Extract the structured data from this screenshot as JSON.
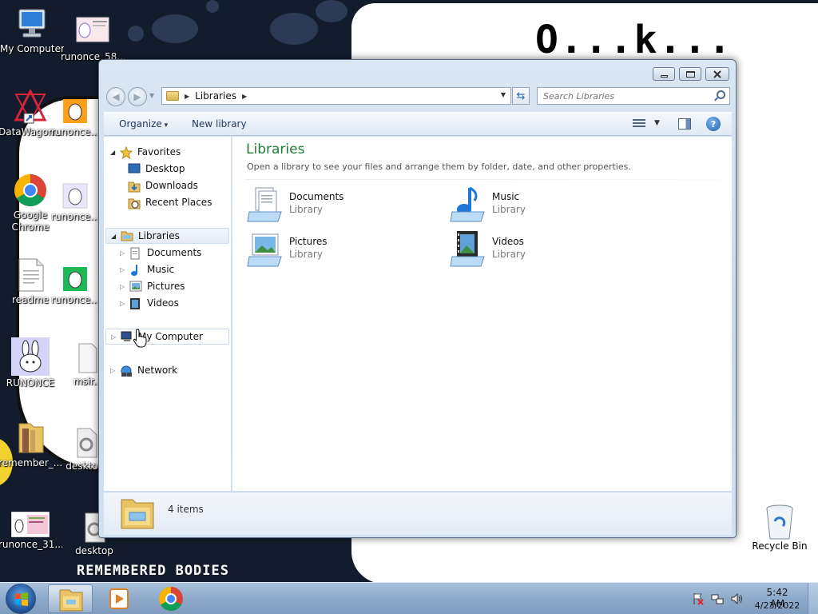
{
  "desktop": {
    "wallpaper_text": "O...k...",
    "wallpaper_bottom_text": "REMEMBERED BODIES",
    "icons": [
      {
        "label": "My Computer",
        "icon": "computer-icon"
      },
      {
        "label": "runonce_58...",
        "icon": "image-file-icon"
      },
      {
        "label": "DataWagon...",
        "icon": "shortcut-icon"
      },
      {
        "label": "runonce...",
        "icon": "image-file-icon"
      },
      {
        "label": "Google Chrome",
        "icon": "chrome-icon"
      },
      {
        "label": "runonce...",
        "icon": "image-file-icon"
      },
      {
        "label": "readme",
        "icon": "text-file-icon"
      },
      {
        "label": "runonce...",
        "icon": "image-file-icon"
      },
      {
        "label": "RUNONCE",
        "icon": "bunny-image-icon"
      },
      {
        "label": "msir...",
        "icon": "file-icon"
      },
      {
        "label": "remember_...",
        "icon": "folder-icon"
      },
      {
        "label": "deskto...",
        "icon": "settings-file-icon"
      },
      {
        "label": "runonce_31...",
        "icon": "image-file-icon"
      },
      {
        "label": "desktop",
        "icon": "settings-file-icon"
      },
      {
        "label": "Recycle Bin",
        "icon": "recycle-bin-icon"
      }
    ]
  },
  "window": {
    "address": {
      "crumbs": [
        "Libraries"
      ]
    },
    "search": {
      "placeholder": "Search Libraries"
    },
    "toolbar": {
      "organize": "Organize",
      "new_library": "New library"
    },
    "nav": {
      "favorites": "Favorites",
      "favorites_items": [
        "Desktop",
        "Downloads",
        "Recent Places"
      ],
      "libraries": "Libraries",
      "libraries_items": [
        "Documents",
        "Music",
        "Pictures",
        "Videos"
      ],
      "computer": "My Computer",
      "network": "Network"
    },
    "content": {
      "title": "Libraries",
      "description": "Open a library to see your files and arrange them by folder, date, and other properties.",
      "libraries": [
        {
          "name": "Documents",
          "type": "Library",
          "icon": "documents-library-icon"
        },
        {
          "name": "Music",
          "type": "Library",
          "icon": "music-library-icon"
        },
        {
          "name": "Pictures",
          "type": "Library",
          "icon": "pictures-library-icon"
        },
        {
          "name": "Videos",
          "type": "Library",
          "icon": "videos-library-icon"
        }
      ]
    },
    "details": {
      "item_count": "4 items"
    }
  },
  "taskbar": {
    "pinned": [
      "windows-explorer-icon",
      "media-player-icon",
      "chrome-icon"
    ],
    "clock": {
      "time": "5:42 AM",
      "date": "4/23/2022"
    }
  },
  "colors": {
    "library_title": "#1e7d35",
    "taskbar": "#8eaaca",
    "window_frame": "#c9d8ea"
  }
}
